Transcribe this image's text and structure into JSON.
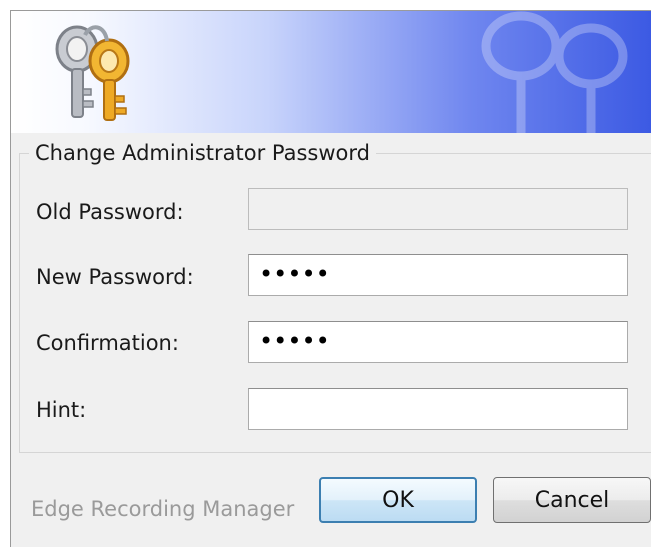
{
  "dialog": {
    "group_title": "Change Administrator Password",
    "fields": [
      {
        "label": "Old Password:",
        "value": "",
        "disabled": true
      },
      {
        "label": "New Password:",
        "value": "•••••"
      },
      {
        "label": "Confirmation:",
        "value": "•••••"
      },
      {
        "label": "Hint:",
        "value": ""
      }
    ],
    "footer_label": "Edge Recording Manager",
    "ok_label": "OK",
    "cancel_label": "Cancel"
  },
  "icons": {
    "banner_icon": "keys-icon",
    "watermark": "keys-watermark-icon"
  },
  "colors": {
    "banner_accent": "#3c5ae3",
    "ok_border": "#3c7fb1"
  }
}
